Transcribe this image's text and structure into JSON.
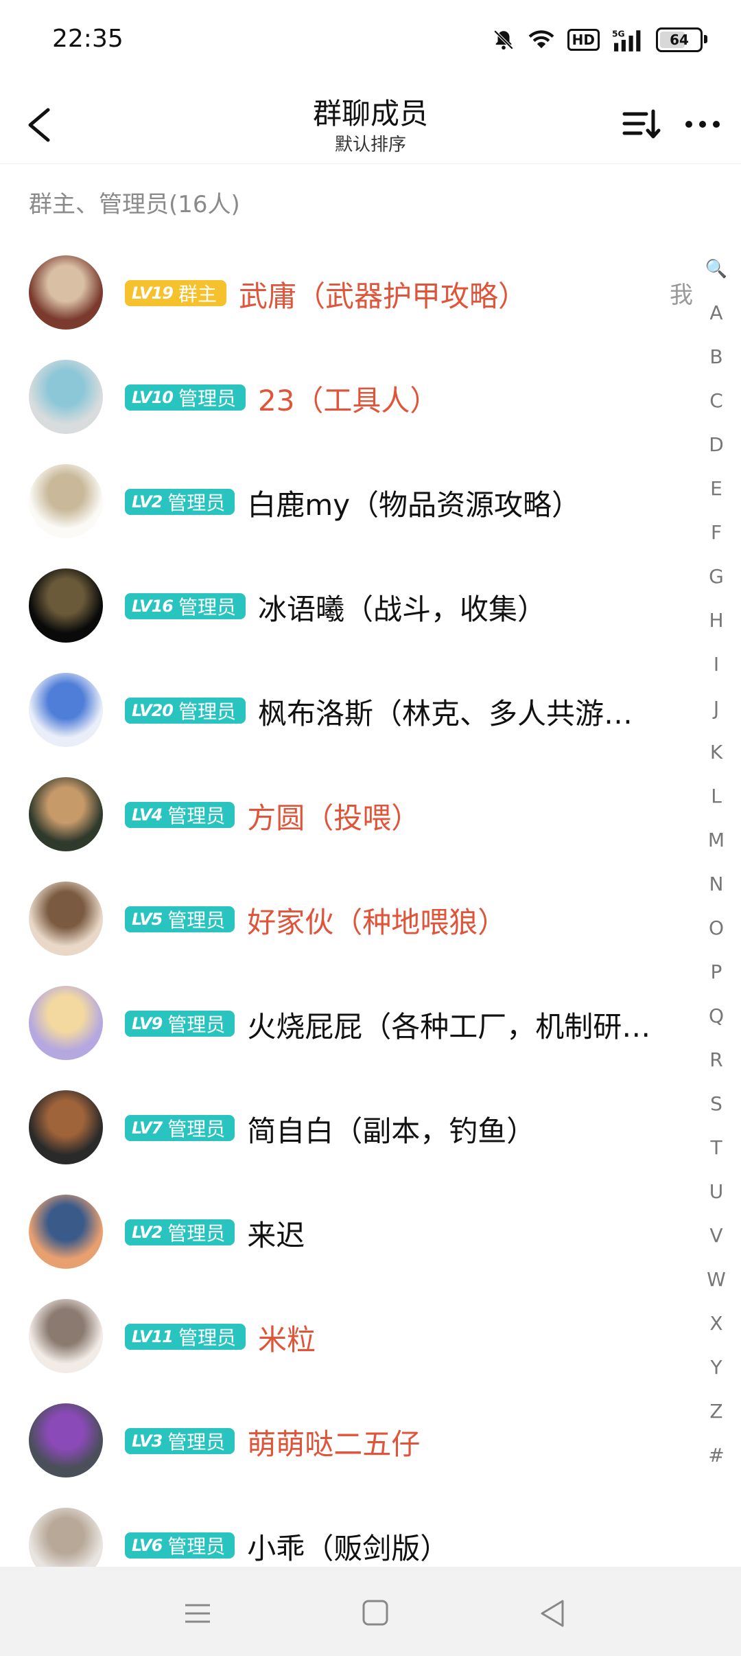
{
  "status": {
    "time": "22:35",
    "battery": "64",
    "battery_level": 0.64
  },
  "header": {
    "title": "群聊成员",
    "subtitle": "默认排序"
  },
  "section": {
    "title": "群主、管理员(16人)"
  },
  "members": [
    {
      "level": "LV19",
      "role": "群主",
      "name": "武庸（武器护甲攻略）",
      "red": true,
      "me": "我",
      "avatar_color": "#7a3b2e",
      "avatar_color2": "#d9c0a5"
    },
    {
      "level": "LV10",
      "role": "管理员",
      "name": "23（工具人）",
      "red": true,
      "me": "",
      "avatar_color": "#d8dcdc",
      "avatar_color2": "#8cc7d8"
    },
    {
      "level": "LV2",
      "role": "管理员",
      "name": "白鹿my（物品资源攻略）",
      "red": false,
      "me": "",
      "avatar_color": "#fbfaf6",
      "avatar_color2": "#c9b99a"
    },
    {
      "level": "LV16",
      "role": "管理员",
      "name": "冰语曦（战斗，收集）",
      "red": false,
      "me": "",
      "avatar_color": "#0a0a0a",
      "avatar_color2": "#6a5a3a"
    },
    {
      "level": "LV20",
      "role": "管理员",
      "name": "枫布洛斯（林克、多人共游…",
      "red": false,
      "me": "",
      "avatar_color": "#e9eef8",
      "avatar_color2": "#4f7ed8"
    },
    {
      "level": "LV4",
      "role": "管理员",
      "name": "方圆（投喂）",
      "red": true,
      "me": "",
      "avatar_color": "#2f3a2c",
      "avatar_color2": "#c79a6a"
    },
    {
      "level": "LV5",
      "role": "管理员",
      "name": "好家伙（种地喂狼）",
      "red": true,
      "me": "",
      "avatar_color": "#e9d8c8",
      "avatar_color2": "#7a5a40"
    },
    {
      "level": "LV9",
      "role": "管理员",
      "name": "火烧屁屁（各种工厂，机制研…",
      "red": false,
      "me": "",
      "avatar_color": "#b5a8e0",
      "avatar_color2": "#f3d9a0"
    },
    {
      "level": "LV7",
      "role": "管理员",
      "name": "简自白（副本，钓鱼）",
      "red": false,
      "me": "",
      "avatar_color": "#2a2a2a",
      "avatar_color2": "#a0643a"
    },
    {
      "level": "LV2",
      "role": "管理员",
      "name": "来迟",
      "red": false,
      "me": "",
      "avatar_color": "#e8a070",
      "avatar_color2": "#3a5a8a"
    },
    {
      "level": "LV11",
      "role": "管理员",
      "name": "米粒",
      "red": true,
      "me": "",
      "avatar_color": "#f2ebe6",
      "avatar_color2": "#8a7a70"
    },
    {
      "level": "LV3",
      "role": "管理员",
      "name": "萌萌哒二五仔",
      "red": true,
      "me": "",
      "avatar_color": "#4a4f5a",
      "avatar_color2": "#8a4ab8"
    },
    {
      "level": "LV6",
      "role": "管理员",
      "name": "小乖（贩剑版）",
      "red": false,
      "me": "",
      "avatar_color": "#e8e4e0",
      "avatar_color2": "#b8a898"
    }
  ],
  "index_bar": [
    "🔍",
    "A",
    "B",
    "C",
    "D",
    "E",
    "F",
    "G",
    "H",
    "I",
    "J",
    "K",
    "L",
    "M",
    "N",
    "O",
    "P",
    "Q",
    "R",
    "S",
    "T",
    "U",
    "V",
    "W",
    "X",
    "Y",
    "Z",
    "#"
  ],
  "icons": {
    "back": "back-chevron-icon",
    "sort": "sort-icon",
    "more": "more-dots-icon",
    "nav_menu": "menu-icon",
    "nav_home": "home-square-icon",
    "nav_back": "back-triangle-icon"
  },
  "colors": {
    "owner_badge": "#f5c22e",
    "admin_badge": "#29c4bf",
    "red_name": "#e0543a"
  }
}
